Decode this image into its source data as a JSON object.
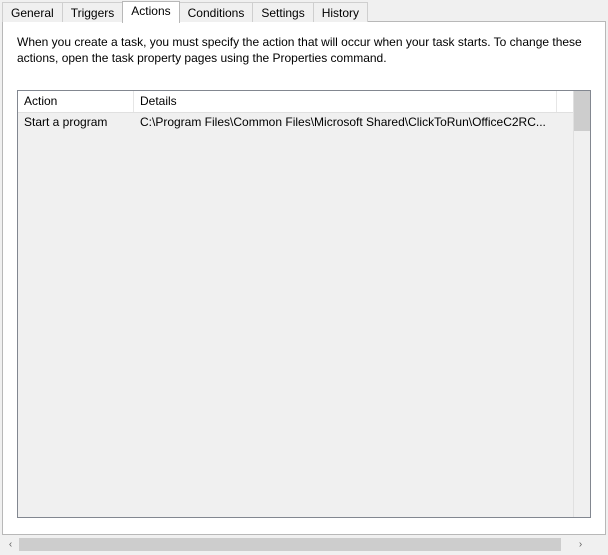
{
  "tabs": [
    {
      "label": "General"
    },
    {
      "label": "Triggers"
    },
    {
      "label": "Actions"
    },
    {
      "label": "Conditions"
    },
    {
      "label": "Settings"
    },
    {
      "label": "History"
    }
  ],
  "active_tab_index": 2,
  "description": "When you create a task, you must specify the action that will occur when your task starts.  To change these actions, open the task property pages using the Properties command.",
  "columns": {
    "action": "Action",
    "details": "Details"
  },
  "rows": [
    {
      "action": "Start a program",
      "details": "C:\\Program Files\\Common Files\\Microsoft Shared\\ClickToRun\\OfficeC2RC..."
    }
  ],
  "glyphs": {
    "left": "‹",
    "right": "›"
  }
}
